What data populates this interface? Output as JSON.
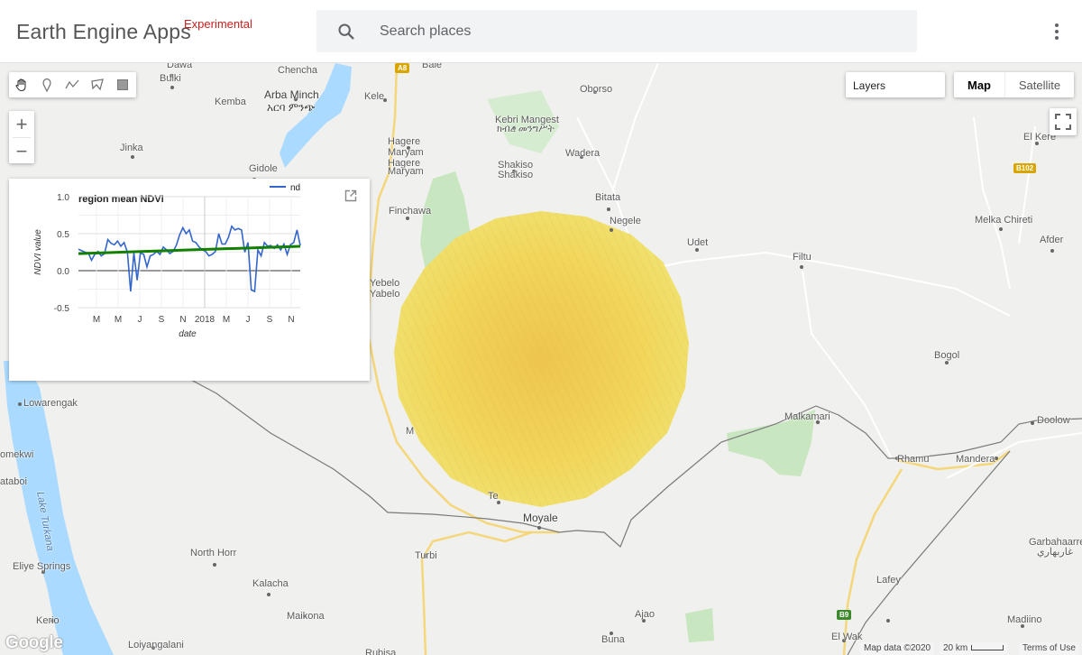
{
  "header": {
    "app_title": "Earth Engine Apps",
    "badge": "Experimental",
    "search_placeholder": "Search places",
    "more_icon": "more-vert-icon"
  },
  "map_controls": {
    "draw_tools": [
      "hand-icon",
      "marker-icon",
      "polyline-icon",
      "polygon-icon",
      "rectangle-icon"
    ],
    "zoom_in": "+",
    "zoom_out": "−",
    "layers_label": "Layers",
    "map_type": {
      "map": "Map",
      "satellite": "Satellite"
    },
    "fullscreen_icon": "fullscreen-icon"
  },
  "places": {
    "chencha": "Chencha",
    "bulki": "Bulki",
    "arba_minch": "Arba Minch",
    "arba_minch_am": "አርባ ምንጭ",
    "kele": "Kele",
    "kemba": "Kemba",
    "jinka": "Jinka",
    "gidole": "Gidole",
    "oborso": "Oborso",
    "kebri_mangest": "Kebri Mangest",
    "kebri_mangest_am": "ክብረ መንግሥት",
    "wadera": "Wadera",
    "hagere_maryam_1": "Hagere",
    "hagere_maryam_2": "Maryam",
    "hagere_maryam_3": "Hagere",
    "hagere_maryam_4": "Maryam",
    "shakiso": "Shakiso",
    "shakiso_2": "Shakiso",
    "finchawa": "Finchawa",
    "bitata": "Bitata",
    "negele": "Negele",
    "udet": "Udet",
    "filtu": "Filtu",
    "el_kere": "El Kere",
    "melka_chireti": "Melka Chireti",
    "afder": "Afder",
    "yebelo": "Yebelo",
    "yabelo": "Yabelo",
    "bogol": "Bogol",
    "malkamari": "Malkamari",
    "doolow": "Doolow",
    "rhamu": "Rhamu",
    "mandera": "Mandera",
    "lowarengak": "Lowarengak",
    "lomekwi": "omekwi",
    "kataboi": "ataboi",
    "lake_turkana": "Lake Turkana",
    "moyale": "Moyale",
    "north_horr": "North Horr",
    "turbi": "Turbi",
    "eliye_springs": "Eliye Springs",
    "kalacha": "Kalacha",
    "kerio": "Kerio",
    "maikona": "Maikona",
    "ajao": "Ajao",
    "buna": "Buna",
    "loiyangalani": "Loiyangalani",
    "lafey": "Lafey",
    "madiino": "Madiino",
    "garbahaarre": "Garbahaarre",
    "garbahaarre_ar": "غاربهاري",
    "el_wak": "El Wak",
    "rubisa": "Rubisa",
    "dawa": "Dawa",
    "bale": "Bale",
    "ma": "M",
    "te": "Te"
  },
  "road_shields": {
    "a8": "A8",
    "b102": "B102",
    "b9": "B9"
  },
  "chart": {
    "panel_title": "region mean NDVI",
    "open_icon": "open-in-new-icon"
  },
  "chart_data": {
    "type": "line",
    "title": "region mean NDVI",
    "xlabel": "date",
    "ylabel": "NDVI value",
    "ylim": [
      -0.5,
      1.0
    ],
    "y_ticks": [
      "1.0",
      "0.5",
      "0.0",
      "-0.5"
    ],
    "x_ticks": [
      "M",
      "M",
      "J",
      "S",
      "N",
      "2018",
      "M",
      "J",
      "S",
      "N"
    ],
    "legend": "top-right",
    "series": [
      {
        "name": "nd",
        "color": "#3366cc",
        "values": [
          0.29,
          0.27,
          0.25,
          0.24,
          0.14,
          0.22,
          0.26,
          0.2,
          0.23,
          0.42,
          0.37,
          0.35,
          0.4,
          0.33,
          0.38,
          0.25,
          -0.28,
          0.24,
          -0.13,
          0.24,
          0.22,
          0.05,
          0.2,
          0.22,
          0.26,
          0.22,
          0.32,
          0.28,
          0.23,
          0.26,
          0.34,
          0.48,
          0.58,
          0.5,
          0.55,
          0.4,
          0.38,
          0.32,
          0.28,
          0.26,
          0.2,
          0.22,
          0.26,
          0.5,
          0.36,
          0.36,
          0.45,
          0.6,
          0.55,
          0.57,
          0.55,
          0.25,
          0.38,
          -0.26,
          -0.28,
          0.28,
          0.2,
          0.38,
          0.33,
          0.34,
          0.3,
          0.35,
          0.28,
          0.36,
          0.22,
          0.35,
          0.38,
          0.55,
          0.34
        ]
      },
      {
        "name": "trend",
        "color": "#138000",
        "values_start_end": [
          0.23,
          0.33
        ]
      }
    ]
  },
  "footer": {
    "google": "Google",
    "map_data": "Map data ©2020",
    "scale": "20 km",
    "terms": "Terms of Use"
  },
  "colors": {
    "water": "#aadaff",
    "park": "#c8e6c0",
    "road": "#f5d77a",
    "ndvi_overlay": "#f0d050",
    "border": "#7a7a7a"
  }
}
